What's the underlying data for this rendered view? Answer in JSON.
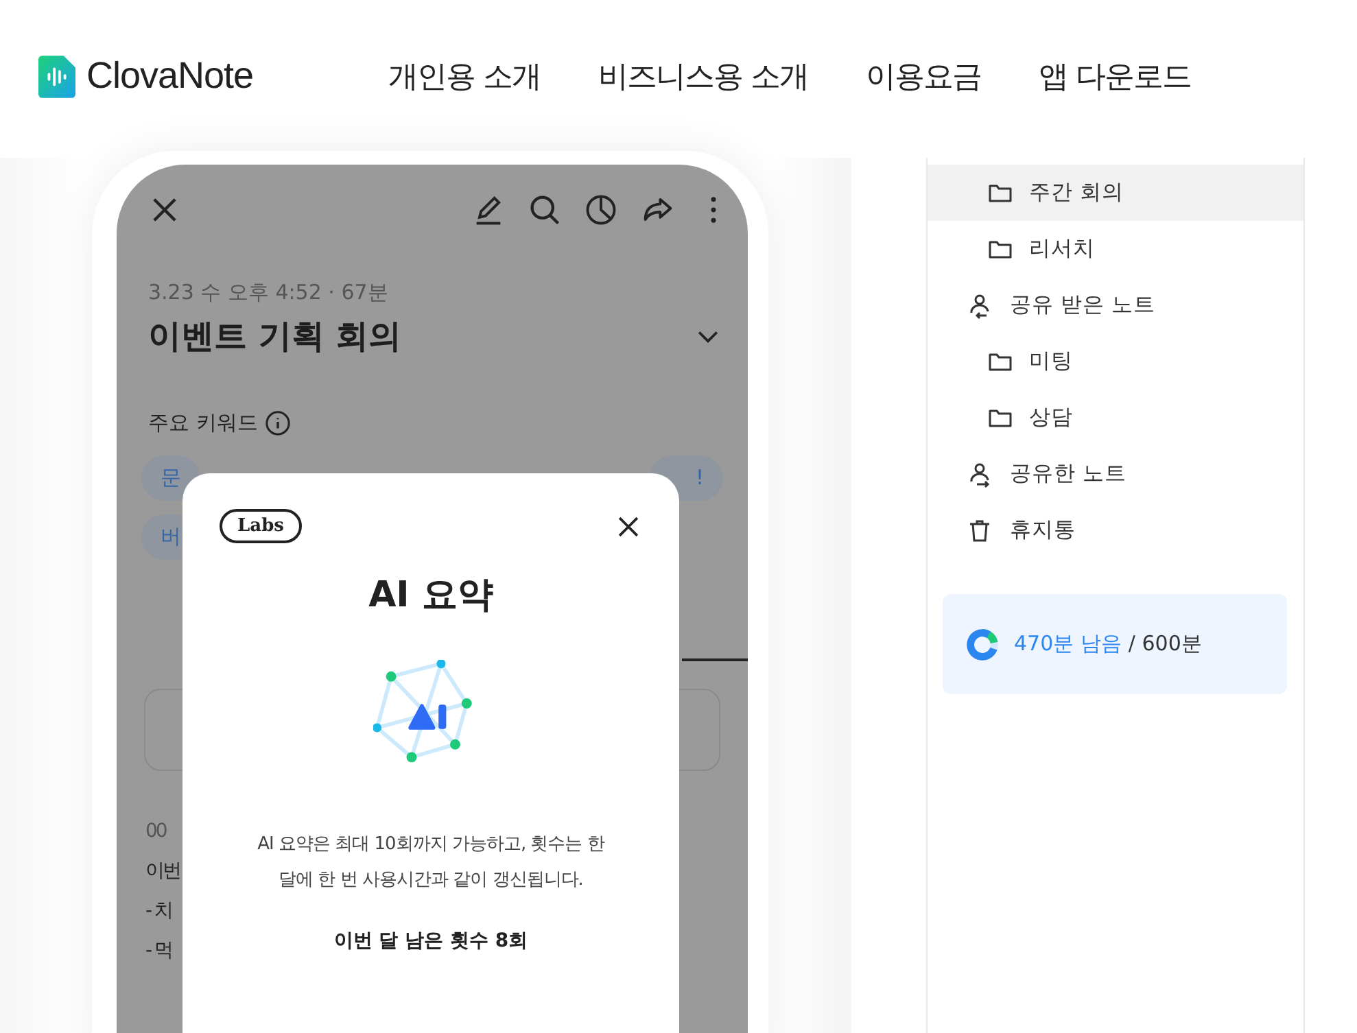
{
  "header": {
    "logo": "ClovaNote",
    "nav": [
      "개인용 소개",
      "비즈니스용 소개",
      "이용요금",
      "앱 다운로드"
    ]
  },
  "note": {
    "meta": "3.23 수 오후 4:52 · 67분",
    "title": "이벤트 기획 회의",
    "keywords_label": "주요 키워드",
    "chips": [
      "문",
      "!",
      "버"
    ],
    "transcript": [
      "00",
      "이번",
      "- 치",
      "- 먹"
    ]
  },
  "modal": {
    "badge": "Labs",
    "title": "AI 요약",
    "description": "AI 요약은 최대 10회까지 가능하고, 횟수는 한달에 한 번 사용시간과 같이 갱신됩니다.",
    "remaining": "이번 달 남은 횟수 8회"
  },
  "sidebar": {
    "continued_items": [
      {
        "kind": "folder",
        "label": "주간 회의",
        "selected": true
      },
      {
        "kind": "folder",
        "label": "리서치",
        "selected": false
      }
    ],
    "items": [
      {
        "kind": "shared-in",
        "label": "공유 받은 노트",
        "selected": false,
        "children": [
          {
            "kind": "folder",
            "label": "미팅",
            "selected": false
          },
          {
            "kind": "folder",
            "label": "상담",
            "selected": false
          }
        ]
      },
      {
        "kind": "shared-out",
        "label": "공유한 노트",
        "selected": false
      },
      {
        "kind": "trash",
        "label": "휴지통",
        "selected": false
      }
    ],
    "usage": {
      "remaining": "470분 남음",
      "total": "/ 600분",
      "level": 0.78
    }
  }
}
